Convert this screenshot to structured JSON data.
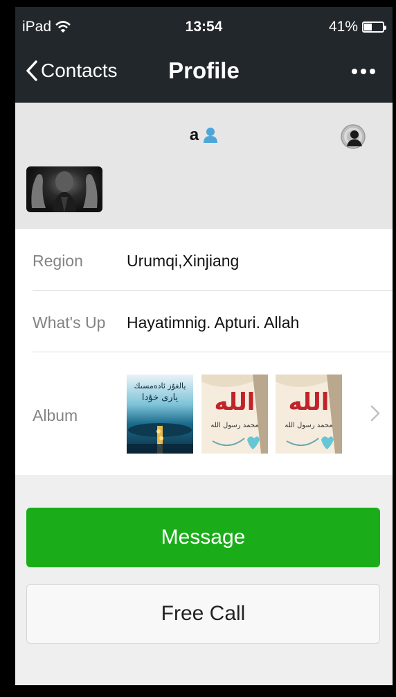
{
  "status": {
    "device": "iPad",
    "time": "13:54",
    "battery": "41%"
  },
  "nav": {
    "back_label": "Contacts",
    "title": "Profile"
  },
  "profile": {
    "name": "a"
  },
  "info": {
    "region_label": "Region",
    "region_value": "Urumqi,Xinjiang",
    "whatsup_label": "What's Up",
    "whatsup_value": "Hayatimnig.  Apturi.  Allah",
    "album_label": "Album",
    "album_items": [
      {
        "caption_line1": "يالغۇز ئادەمسىك",
        "caption_line2": "يارى خۇدا"
      },
      {
        "caption_main": "الله",
        "caption_sub": "محمد رسول الله"
      },
      {
        "caption_main": "الله",
        "caption_sub": "محمد رسول الله"
      }
    ]
  },
  "actions": {
    "message_label": "Message",
    "call_label": "Free Call"
  },
  "colors": {
    "nav_bg": "#22272b",
    "accent_green": "#1aad19",
    "person_icon": "#4da6d8"
  },
  "icons": [
    "wifi-icon",
    "battery-icon",
    "chevron-left-icon",
    "more-icon",
    "person-icon",
    "settings-icon",
    "chevron-right-icon"
  ]
}
